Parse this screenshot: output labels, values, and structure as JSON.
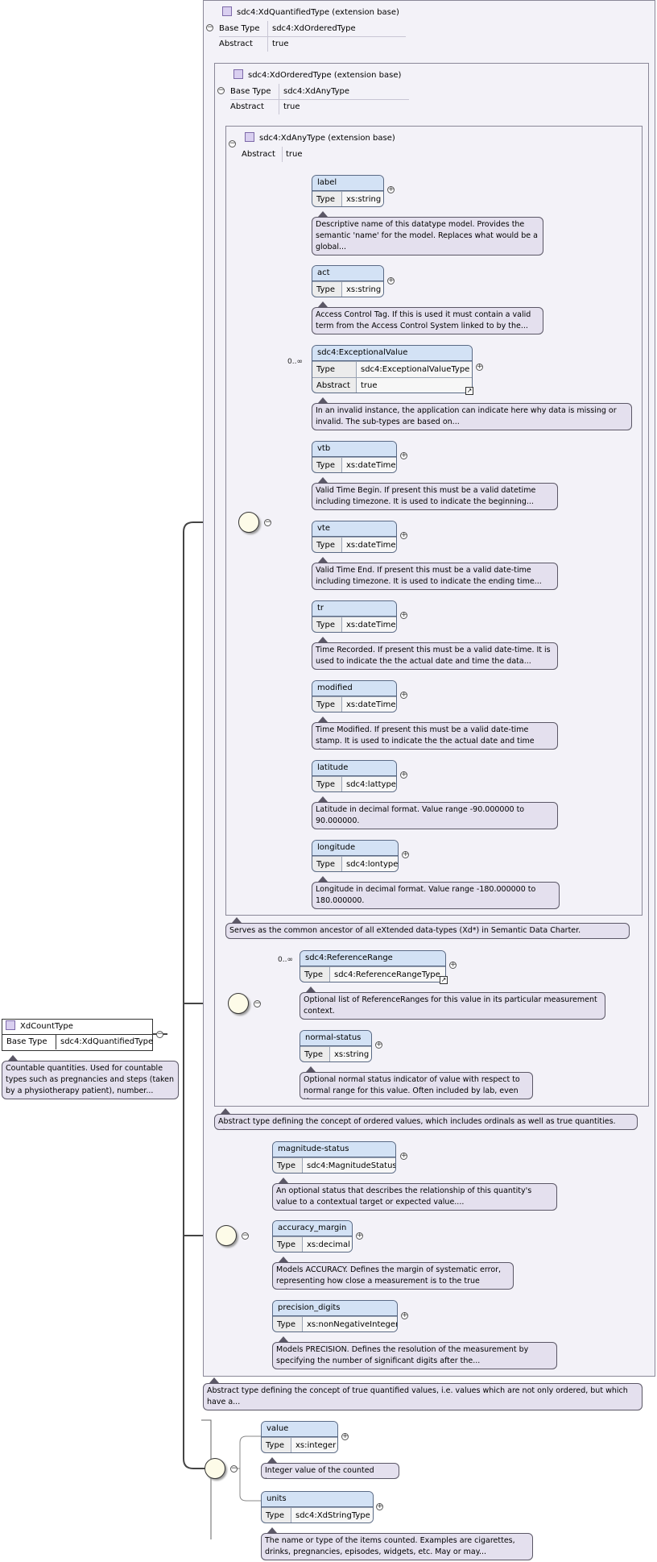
{
  "root": {
    "name": "XdCountType",
    "base_type_key": "Base Type",
    "base_type_value": "sdc4:XdQuantifiedType",
    "doc": "Countable quantities. Used for countable types such as pregnancies and steps (taken by a physiotherapy patient), number..."
  },
  "ext_quantified": {
    "title": "sdc4:XdQuantifiedType (extension base)",
    "base_type_key": "Base Type",
    "base_type_value": "sdc4:XdOrderedType",
    "abstract_key": "Abstract",
    "abstract_value": "true",
    "doc": "Abstract type defining the concept of true quantified values, i.e. values which are not only ordered, but which have a..."
  },
  "ext_ordered": {
    "title": "sdc4:XdOrderedType (extension base)",
    "base_type_key": "Base Type",
    "base_type_value": "sdc4:XdAnyType",
    "abstract_key": "Abstract",
    "abstract_value": "true",
    "doc": "Abstract type defining the concept of ordered values, which includes ordinals as well as true quantities. The..."
  },
  "ext_any": {
    "title": "sdc4:XdAnyType (extension base)",
    "abstract_key": "Abstract",
    "abstract_value": "true",
    "doc": "Serves as the common ancestor of all eXtended data-types (Xd*) in Semantic Data Charter."
  },
  "type_key": "Type",
  "abstract_key": "Abstract",
  "occurrence": "0..∞",
  "any_elements": [
    {
      "name": "label",
      "type": "xs:string",
      "doc": "Descriptive name of this datatype model. Provides the semantic 'name' for the model. Replaces what would be a global..."
    },
    {
      "name": "act",
      "type": "xs:string",
      "doc": "Access Control Tag. If this is used it must contain a valid term from the Access Control System linked to by the..."
    },
    {
      "name": "sdc4:ExceptionalValue",
      "type": "sdc4:ExceptionalValueType",
      "abstract": "true",
      "doc": "In an invalid instance, the application can indicate here why data is missing or invalid. The sub-types are based on..."
    },
    {
      "name": "vtb",
      "type": "xs:dateTime",
      "doc": "Valid Time Begin. If present this must be a valid datetime including timezone. It is used to indicate the beginning..."
    },
    {
      "name": "vte",
      "type": "xs:dateTime",
      "doc": "Valid Time End. If present this must be a valid date-time including timezone. It is used to indicate the ending time..."
    },
    {
      "name": "tr",
      "type": "xs:dateTime",
      "doc": "Time Recorded. If present this must be a valid date-time. It is used to indicate the the actual date and time the data..."
    },
    {
      "name": "modified",
      "type": "xs:dateTime",
      "doc": "Time Modified. If present this must be a valid date-time stamp. It is used to indicate the the actual date and time the..."
    },
    {
      "name": "latitude",
      "type": "sdc4:lattype",
      "doc": "Latitude in decimal format. Value range -90.000000 to 90.000000."
    },
    {
      "name": "longitude",
      "type": "sdc4:lontype",
      "doc": "Longitude in decimal format. Value range -180.000000 to 180.000000."
    }
  ],
  "ordered_elements": [
    {
      "name": "sdc4:ReferenceRange",
      "type": "sdc4:ReferenceRangeType",
      "doc": "Optional list of ReferenceRanges for this value in its particular measurement context."
    },
    {
      "name": "normal-status",
      "type": "xs:string",
      "doc": "Optional normal status indicator of value with respect to normal range for this value. Often included by lab, even if..."
    }
  ],
  "quantified_elements": [
    {
      "name": "magnitude-status",
      "type": "sdc4:MagnitudeStatus",
      "doc": "An optional status that describes the relationship of this quantity's value to a contextual target or expected value...."
    },
    {
      "name": "accuracy_margin",
      "type": "xs:decimal",
      "doc": "Models ACCURACY. Defines the margin of systematic error, representing how close a measurement is to the true value...."
    },
    {
      "name": "precision_digits",
      "type": "xs:nonNegativeInteger",
      "doc": "Models PRECISION. Defines the resolution of the measurement by specifying the number of significant digits after the..."
    }
  ],
  "count_elements": [
    {
      "name": "value",
      "type": "xs:integer",
      "doc": "Integer value of the counted items."
    },
    {
      "name": "units",
      "type": "sdc4:XdStringType",
      "doc": "The name or type of the items counted. Examples are cigarettes, drinks, pregnancies, episodes, widgets, etc. May or may..."
    }
  ]
}
